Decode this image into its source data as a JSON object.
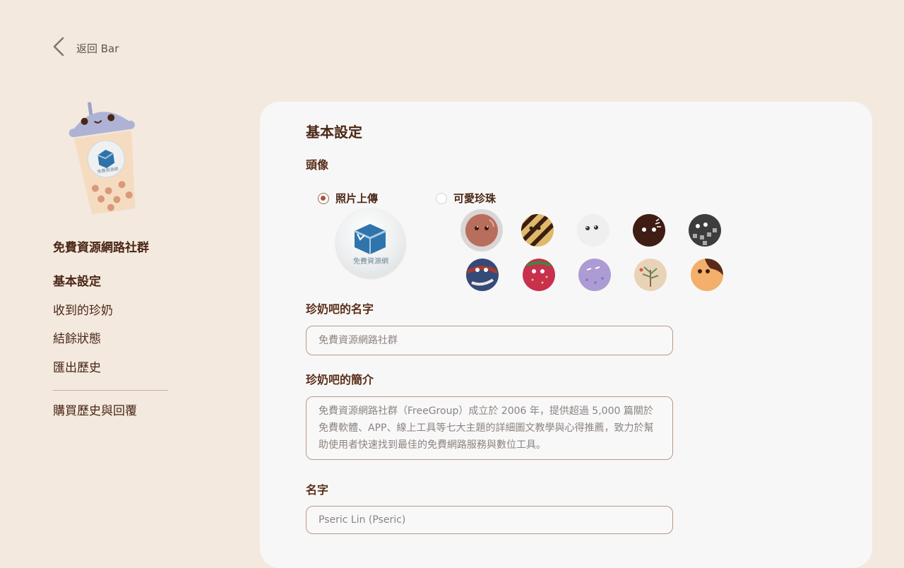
{
  "nav_back": {
    "label": "返回 Bar"
  },
  "sidebar": {
    "group_name": "免費資源網路社群",
    "logo_text": "免費資源網",
    "items": [
      {
        "label": "基本設定",
        "active": true
      },
      {
        "label": "收到的珍奶",
        "active": false
      },
      {
        "label": "結餘狀態",
        "active": false
      },
      {
        "label": "匯出歷史",
        "active": false
      },
      {
        "label": "購買歷史與回覆",
        "active": false
      }
    ]
  },
  "main": {
    "title": "基本設定",
    "avatar": {
      "label": "頭像",
      "option_upload": "照片上傳",
      "option_pearls": "可愛珍珠",
      "selected_option": "照片上傳",
      "upload_caption": "免費資源網",
      "pearls": [
        {
          "name": "pearl-brown",
          "color": "#b86e5c",
          "selected": true
        },
        {
          "name": "pearl-striped",
          "color": "#e0b86a",
          "selected": false
        },
        {
          "name": "pearl-white",
          "color": "#efefef",
          "selected": false
        },
        {
          "name": "pearl-dark",
          "color": "#3f1d14",
          "selected": false
        },
        {
          "name": "pearl-charcoal",
          "color": "#3d3d3d",
          "selected": false
        },
        {
          "name": "pearl-navy",
          "color": "#344a7a",
          "selected": false
        },
        {
          "name": "pearl-crimson",
          "color": "#c8304d",
          "selected": false
        },
        {
          "name": "pearl-lavender",
          "color": "#ad9bd3",
          "selected": false
        },
        {
          "name": "pearl-beige",
          "color": "#e9d3b8",
          "selected": false
        },
        {
          "name": "pearl-orange",
          "color": "#f2b06c",
          "selected": false
        }
      ]
    },
    "bar_name": {
      "label": "珍奶吧的名字",
      "placeholder": "免費資源網路社群"
    },
    "bar_intro": {
      "label": "珍奶吧的簡介",
      "placeholder": "免費資源網路社群（FreeGroup）成立於 2006 年，提供超過 5,000 篇關於免費軟體、APP、線上工具等七大主題的詳細圖文教學與心得推薦，致力於幫助使用者快速找到最佳的免費網路服務與數位工具。"
    },
    "name": {
      "label": "名字",
      "placeholder": "Pseric Lin (Pseric)"
    }
  }
}
